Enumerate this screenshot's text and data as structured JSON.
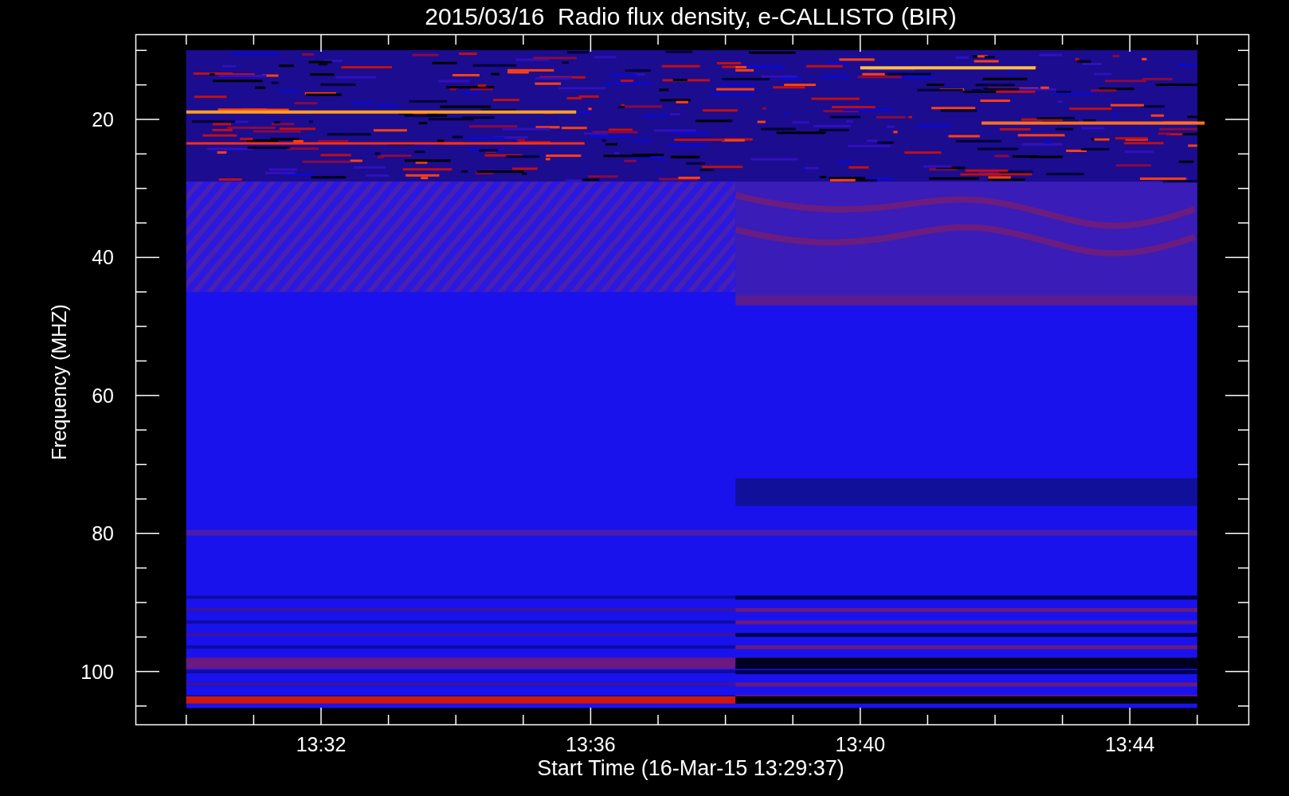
{
  "title": "2015/03/16  Radio flux density, e-CALLISTO (BIR)",
  "y_axis": {
    "label": "Frequency (MHZ)",
    "tick_labels": [
      "20",
      "40",
      "60",
      "80",
      "100"
    ]
  },
  "x_axis": {
    "label": "Start Time (16-Mar-15 13:29:37)",
    "tick_labels": [
      "13:32",
      "13:36",
      "13:40",
      "13:44"
    ]
  }
}
